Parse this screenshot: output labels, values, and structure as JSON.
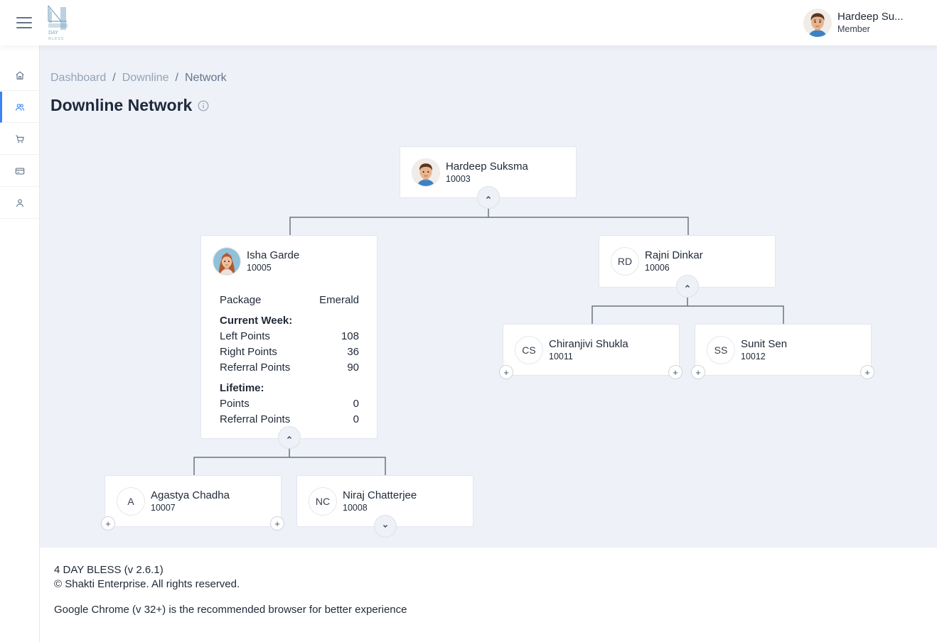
{
  "header": {
    "logo_text_1": "DAY",
    "logo_text_2": "BLESS",
    "user": {
      "name": "Hardeep Su...",
      "role": "Member"
    }
  },
  "sidebar": {
    "items": [
      {
        "icon": "home-icon",
        "label": "Home"
      },
      {
        "icon": "users-icon",
        "label": "Downline",
        "active": true
      },
      {
        "icon": "cart-icon",
        "label": "Shop"
      },
      {
        "icon": "card-icon",
        "label": "Payments"
      },
      {
        "icon": "user-icon",
        "label": "Profile"
      }
    ]
  },
  "breadcrumb": {
    "dashboard": "Dashboard",
    "downline": "Downline",
    "network": "Network",
    "separator": "/"
  },
  "page": {
    "title": "Downline Network"
  },
  "tree": {
    "root": {
      "name": "Hardeep Suksma",
      "id": "10003"
    },
    "left": {
      "name": "Isha Garde",
      "id": "10005",
      "details": {
        "package_label": "Package",
        "package_value": "Emerald",
        "current_week_label": "Current Week:",
        "left_points_label": "Left Points",
        "left_points": "108",
        "right_points_label": "Right Points",
        "right_points": "36",
        "referral_points_label": "Referral Points",
        "referral_points": "90",
        "lifetime_label": "Lifetime:",
        "points_label": "Points",
        "points": "0",
        "lifetime_referral_label": "Referral Points",
        "lifetime_referral": "0"
      }
    },
    "right": {
      "initials": "RD",
      "name": "Rajni Dinkar",
      "id": "10006"
    },
    "left_left": {
      "initials": "A",
      "name": "Agastya Chadha",
      "id": "10007"
    },
    "left_right": {
      "initials": "NC",
      "name": "Niraj Chatterjee",
      "id": "10008"
    },
    "right_left": {
      "initials": "CS",
      "name": "Chiranjivi Shukla",
      "id": "10011"
    },
    "right_right": {
      "initials": "SS",
      "name": "Sunit Sen",
      "id": "10012"
    },
    "plus_symbol": "+"
  },
  "footer": {
    "version": "4 DAY BLESS (v 2.6.1)",
    "copyright": "© Shakti Enterprise. All rights reserved.",
    "browser_note": "Google Chrome (v 32+) is the recommended browser for better experience"
  },
  "colors": {
    "accent": "#3b82f6",
    "main_bg": "#eef1f7",
    "icon_gray": "#64748b"
  }
}
